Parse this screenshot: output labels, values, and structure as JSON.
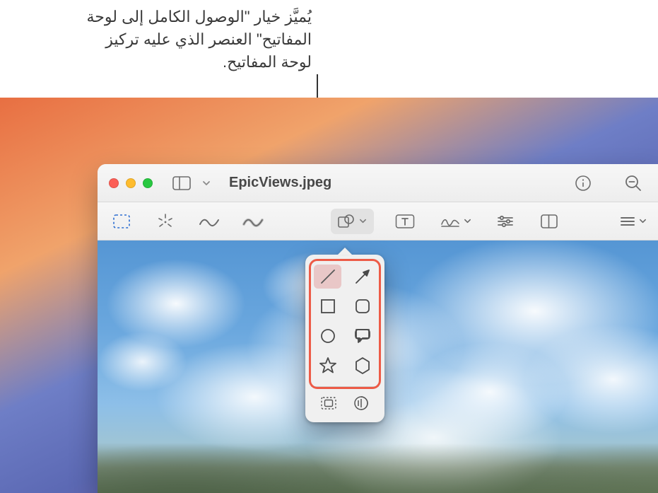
{
  "caption": "يُميَّز خيار \"الوصول الكامل إلى لوحة المفاتيح\" العنصر الذي عليه تركيز لوحة المفاتيح.",
  "window": {
    "filename": "EpicViews.jpeg"
  },
  "toolbar": {
    "sidebar_toggle": "sidebar",
    "info": "info",
    "zoom_out": "zoom out"
  },
  "markup": {
    "selection": "selection",
    "instant_alpha": "instant alpha",
    "draw": "draw",
    "sketch": "sketch",
    "shapes": "shapes",
    "text": "text",
    "sign": "sign",
    "adjust": "adjust color",
    "crop": "crop",
    "more": "more"
  },
  "popover": {
    "items": [
      {
        "name": "line",
        "focused": true
      },
      {
        "name": "arrow",
        "focused": false
      },
      {
        "name": "square",
        "focused": false
      },
      {
        "name": "rounded-square",
        "focused": false
      },
      {
        "name": "circle",
        "focused": false
      },
      {
        "name": "speech-bubble",
        "focused": false
      },
      {
        "name": "star",
        "focused": false
      },
      {
        "name": "hexagon",
        "focused": false
      }
    ],
    "mask": "mask",
    "loupe": "loupe"
  }
}
